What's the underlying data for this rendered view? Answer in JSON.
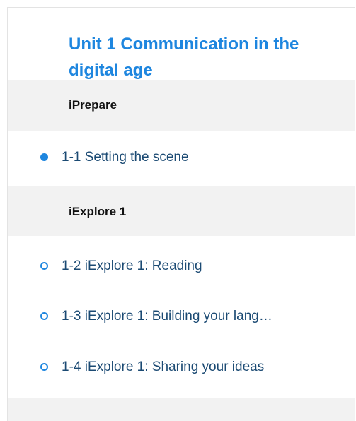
{
  "unit": {
    "title": "Unit 1 Communication in the digital age"
  },
  "sections": [
    {
      "label": "iPrepare"
    },
    {
      "label": "iExplore 1"
    },
    {
      "label": ""
    }
  ],
  "lessons": [
    {
      "label": "1-1 Setting the scene",
      "status": "current"
    },
    {
      "label": "1-2 iExplore 1: Reading",
      "status": "not-started"
    },
    {
      "label": "1-3 iExplore 1: Building your lang…",
      "status": "not-started"
    },
    {
      "label": "1-4 iExplore 1: Sharing your ideas",
      "status": "not-started"
    }
  ],
  "colors": {
    "accent": "#1e86df",
    "section_bg": "#f2f2f2",
    "lesson_text": "#1b4a73"
  }
}
